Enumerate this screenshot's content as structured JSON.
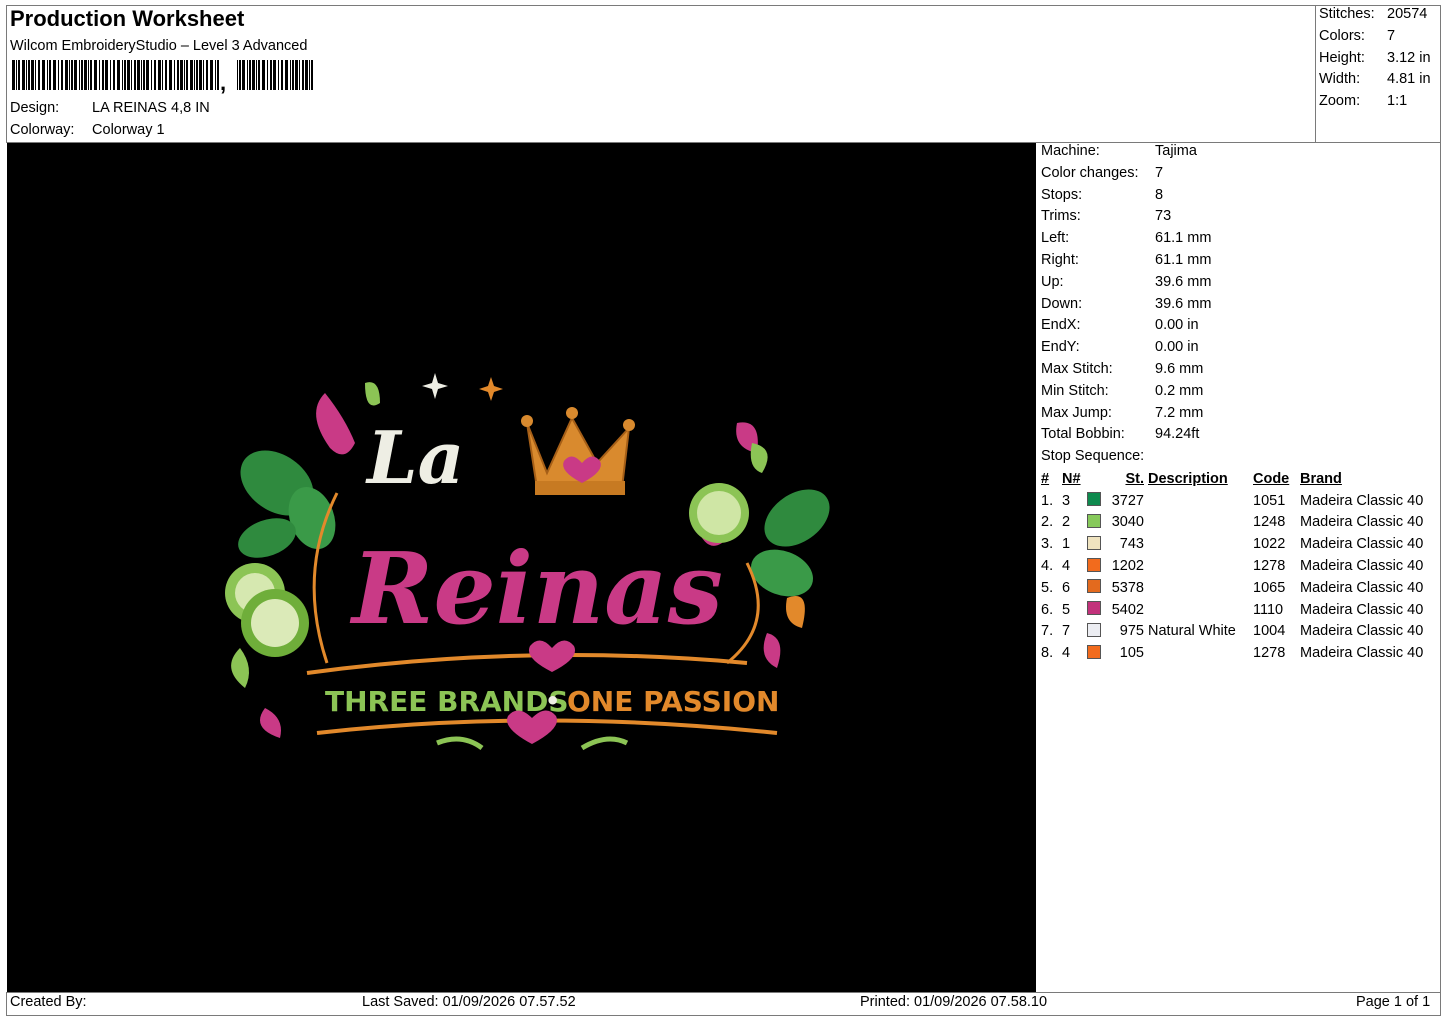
{
  "header": {
    "title": "Production Worksheet",
    "software": "Wilcom EmbroideryStudio – Level 3 Advanced",
    "design_label": "Design:",
    "design_value": "LA REINAS 4,8 IN",
    "colorway_label": "Colorway:",
    "colorway_value": "Colorway 1"
  },
  "summary": [
    {
      "label": "Stitches:",
      "value": "20574"
    },
    {
      "label": "Colors:",
      "value": "7"
    },
    {
      "label": "Height:",
      "value": "3.12 in"
    },
    {
      "label": "Width:",
      "value": "4.81 in"
    },
    {
      "label": "Zoom:",
      "value": "1:1"
    }
  ],
  "machine_info": [
    {
      "label": "Machine:",
      "value": "Tajima"
    },
    {
      "label": "Color changes:",
      "value": "7"
    },
    {
      "label": "Stops:",
      "value": "8"
    },
    {
      "label": "Trims:",
      "value": "73"
    },
    {
      "label": "Left:",
      "value": "61.1 mm"
    },
    {
      "label": "Right:",
      "value": "61.1 mm"
    },
    {
      "label": "Up:",
      "value": "39.6 mm"
    },
    {
      "label": "Down:",
      "value": "39.6 mm"
    },
    {
      "label": "EndX:",
      "value": "0.00 in"
    },
    {
      "label": "EndY:",
      "value": "0.00 in"
    },
    {
      "label": "Max Stitch:",
      "value": "9.6 mm"
    },
    {
      "label": "Min Stitch:",
      "value": "0.2 mm"
    },
    {
      "label": "Max Jump:",
      "value": "7.2 mm"
    },
    {
      "label": "Total Bobbin:",
      "value": "94.24ft"
    }
  ],
  "stop_sequence": {
    "heading": "Stop Sequence:",
    "columns": [
      "#",
      "N#",
      "St.",
      "Description",
      "Code",
      "Brand"
    ],
    "rows": [
      {
        "num": "1.",
        "n": "3",
        "color": "#0e8a4e",
        "st": "3727",
        "desc": "",
        "code": "1051",
        "brand": "Madeira Classic 40"
      },
      {
        "num": "2.",
        "n": "2",
        "color": "#86c95a",
        "st": "3040",
        "desc": "",
        "code": "1248",
        "brand": "Madeira Classic 40"
      },
      {
        "num": "3.",
        "n": "1",
        "color": "#efe3bf",
        "st": "743",
        "desc": "",
        "code": "1022",
        "brand": "Madeira Classic 40"
      },
      {
        "num": "4.",
        "n": "4",
        "color": "#f26b1d",
        "st": "1202",
        "desc": "",
        "code": "1278",
        "brand": "Madeira Classic 40"
      },
      {
        "num": "5.",
        "n": "6",
        "color": "#e36a1e",
        "st": "5378",
        "desc": "",
        "code": "1065",
        "brand": "Madeira Classic 40"
      },
      {
        "num": "6.",
        "n": "5",
        "color": "#c2327b",
        "st": "5402",
        "desc": "",
        "code": "1110",
        "brand": "Madeira Classic 40"
      },
      {
        "num": "7.",
        "n": "7",
        "color": "#ecedf2",
        "st": "975",
        "desc": "Natural White",
        "code": "1004",
        "brand": "Madeira Classic 40"
      },
      {
        "num": "8.",
        "n": "4",
        "color": "#f26b1d",
        "st": "105",
        "desc": "",
        "code": "1278",
        "brand": "Madeira Classic 40"
      }
    ]
  },
  "design_art": {
    "line1": "La",
    "line2": "Reinas",
    "tagline_left": "THREE BRANDS",
    "tagline_sep": "•",
    "tagline_right": "ONE PASSION",
    "colors": {
      "pink": "#c93a86",
      "orange": "#e2892b",
      "green": "#8cc455",
      "leaf": "#2f8a3e",
      "white": "#eeeee4",
      "gold": "#d98a2e"
    }
  },
  "footer": {
    "created_by": "Created By:",
    "last_saved": "Last Saved: 01/09/2026 07.57.52",
    "printed": "Printed: 01/09/2026 07.58.10",
    "page": "Page 1 of 1"
  }
}
